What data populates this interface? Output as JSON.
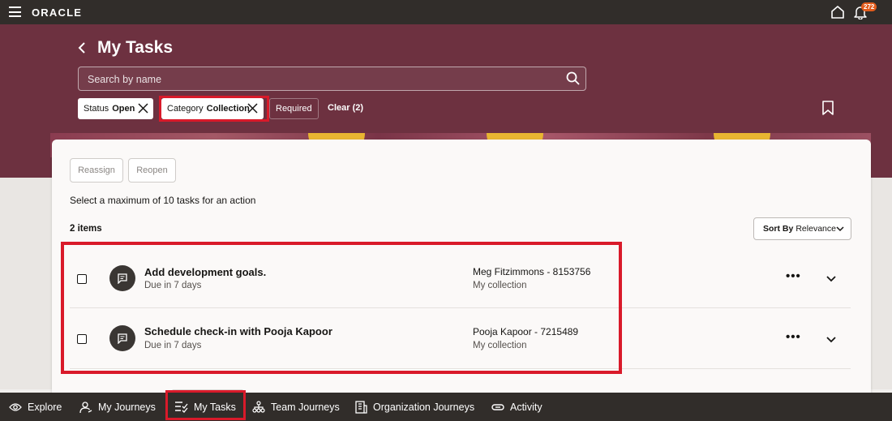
{
  "topbar": {
    "logo": "ORACLE",
    "menu_icon": "hamburger-icon",
    "home_icon": "home-icon",
    "notification_icon": "bell-icon",
    "notification_count": "272"
  },
  "page": {
    "title": "My Tasks",
    "back_icon": "chevron-left-icon"
  },
  "search": {
    "placeholder": "Search by name",
    "value": ""
  },
  "filters": {
    "status": {
      "key": "Status",
      "value": "Open"
    },
    "category": {
      "key": "Category",
      "value": "Collection"
    },
    "required": "Required",
    "clear": "Clear (2)"
  },
  "actions": {
    "reassign": "Reassign",
    "reopen": "Reopen"
  },
  "hint": "Select a maximum of 10 tasks for an action",
  "items_count": "2 items",
  "sort": {
    "label": "Sort By",
    "value": "Relevance"
  },
  "tasks": [
    {
      "title": "Add development goals.",
      "due": "Due in 7 days",
      "person": "Meg Fitzimmons - 8153756",
      "collection": "My collection"
    },
    {
      "title": "Schedule check-in with Pooja Kapoor",
      "due": "Due in 7 days",
      "person": "Pooja Kapoor - 7215489",
      "collection": "My collection"
    }
  ],
  "bottom_nav": {
    "explore": "Explore",
    "my_journeys": "My Journeys",
    "my_tasks": "My Tasks",
    "team_journeys": "Team Journeys",
    "organization_journeys": "Organization Journeys",
    "activity": "Activity"
  },
  "colors": {
    "banner": "#6d3140",
    "topbar": "#312d2a",
    "highlight": "#d91a2a",
    "badge": "#e25b1b"
  }
}
